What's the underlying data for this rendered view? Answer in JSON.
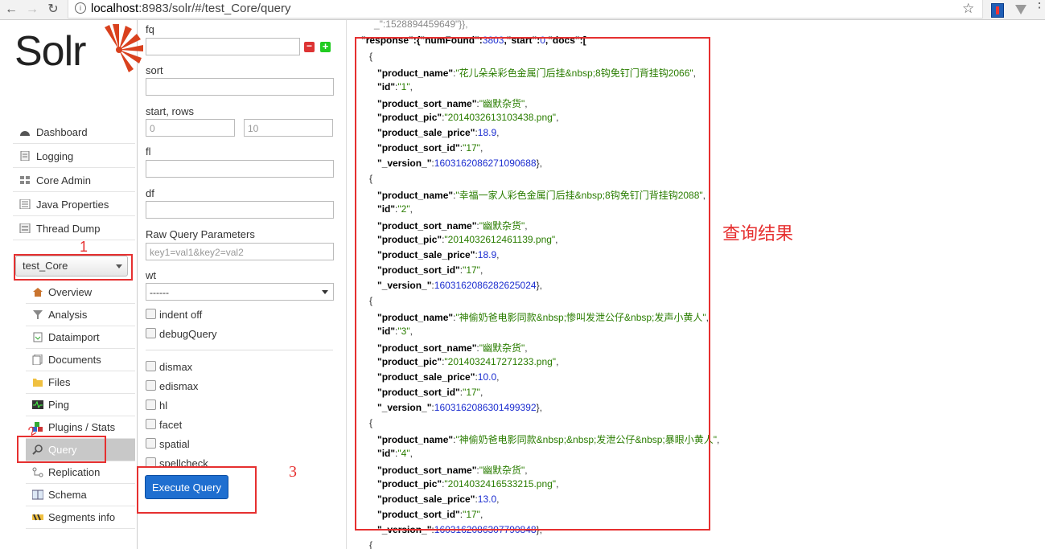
{
  "browser": {
    "url_host": "localhost",
    "url_rest": ":8983/solr/#/test_Core/query"
  },
  "logo": {
    "text": "Solr"
  },
  "nav": [
    {
      "label": "Dashboard",
      "icon": "dashboard-icon"
    },
    {
      "label": "Logging",
      "icon": "logging-icon"
    },
    {
      "label": "Core Admin",
      "icon": "core-admin-icon"
    },
    {
      "label": "Java Properties",
      "icon": "java-properties-icon"
    },
    {
      "label": "Thread Dump",
      "icon": "thread-dump-icon"
    }
  ],
  "core_selector": {
    "value": "test_Core"
  },
  "core_menu": [
    {
      "label": "Overview",
      "icon": "overview-icon"
    },
    {
      "label": "Analysis",
      "icon": "analysis-icon"
    },
    {
      "label": "Dataimport",
      "icon": "dataimport-icon"
    },
    {
      "label": "Documents",
      "icon": "documents-icon"
    },
    {
      "label": "Files",
      "icon": "files-icon"
    },
    {
      "label": "Ping",
      "icon": "ping-icon"
    },
    {
      "label": "Plugins / Stats",
      "icon": "plugins-icon"
    },
    {
      "label": "Query",
      "icon": "query-icon"
    },
    {
      "label": "Replication",
      "icon": "replication-icon"
    },
    {
      "label": "Schema",
      "icon": "schema-icon"
    },
    {
      "label": "Segments info",
      "icon": "segments-icon"
    }
  ],
  "form": {
    "fq_label": "fq",
    "sort_label": "sort",
    "start_rows_label": "start, rows",
    "start_value": "0",
    "rows_value": "10",
    "fl_label": "fl",
    "df_label": "df",
    "raw_label": "Raw Query Parameters",
    "raw_placeholder": "key1=val1&key2=val2",
    "wt_label": "wt",
    "wt_value": "------",
    "indent_label": "indent off",
    "debug_label": "debugQuery",
    "dismax_label": "dismax",
    "edismax_label": "edismax",
    "hl_label": "hl",
    "facet_label": "facet",
    "spatial_label": "spatial",
    "spellcheck_label": "spellcheck",
    "execute_label": "Execute Query"
  },
  "result": {
    "top_line": "_\":1528894459649\"}},",
    "response_line": [
      "\"response\":{\"numFound\":",
      "3803",
      ",\"start\":",
      "0",
      ",\"docs\":["
    ],
    "docs": [
      {
        "product_name": "\"花儿朵朵彩色金属门后挂&nbsp;8钩免钉门背挂钩2066\"",
        "id": "\"1\"",
        "product_sort_name": "\"幽默杂货\"",
        "product_pic": "\"2014032613103438.png\"",
        "product_sale_price": "18.9",
        "product_sort_id": "\"17\"",
        "version": "1603162086271090688"
      },
      {
        "product_name": "\"幸福一家人彩色金属门后挂&nbsp;8钩免钉门背挂钩2088\"",
        "id": "\"2\"",
        "product_sort_name": "\"幽默杂货\"",
        "product_pic": "\"2014032612461139.png\"",
        "product_sale_price": "18.9",
        "product_sort_id": "\"17\"",
        "version": "1603162086282625024"
      },
      {
        "product_name": "\"神偷奶爸电影同款&nbsp;惨叫发泄公仔&nbsp;发声小黄人\"",
        "id": "\"3\"",
        "product_sort_name": "\"幽默杂货\"",
        "product_pic": "\"2014032417271233.png\"",
        "product_sale_price": "10.0",
        "product_sort_id": "\"17\"",
        "version": "1603162086301499392"
      },
      {
        "product_name": "\"神偷奶爸电影同款&nbsp;&nbsp;发泄公仔&nbsp;暴眼小黄人\"",
        "id": "\"4\"",
        "product_sort_name": "\"幽默杂货\"",
        "product_pic": "\"2014032416533215.png\"",
        "product_sale_price": "13.0",
        "product_sort_id": "\"17\"",
        "version": "1603162086307790848"
      }
    ]
  },
  "annotations": {
    "a1": "1",
    "a2": "2",
    "a3": "3",
    "result_note": "查询结果"
  },
  "colors": {
    "annotation": "#e63030",
    "accent": "#1f6fd0"
  }
}
